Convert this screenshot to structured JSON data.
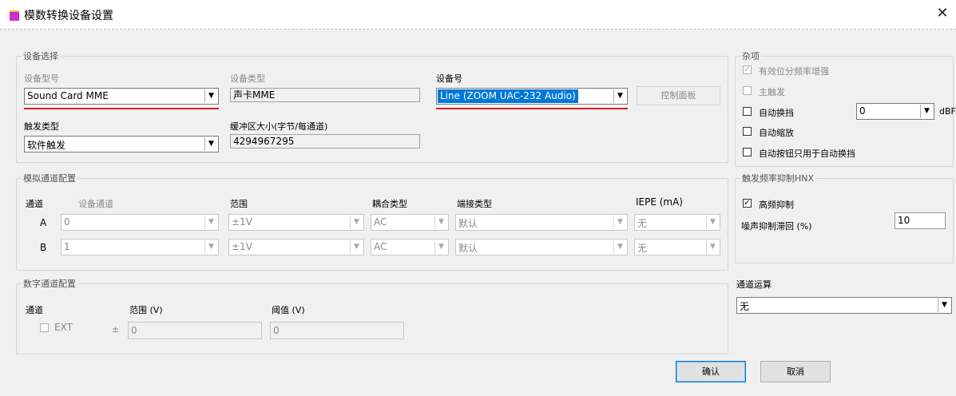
{
  "window": {
    "title": "模数转换设备设置",
    "close_glyph": "✕"
  },
  "device_select": {
    "legend": "设备选择",
    "model_label": "设备型号",
    "model_value": "Sound Card MME",
    "type_label": "设备类型",
    "type_value": "声卡MME",
    "number_label": "设备号",
    "number_value": "Line (ZOOM UAC-232 Audio)",
    "control_panel_button": "控制面板",
    "trigger_label": "触发类型",
    "trigger_value": "软件触发",
    "buffer_label": "缓冲区大小(字节/每通道)",
    "buffer_value": "4294967295"
  },
  "misc": {
    "legend": "杂项",
    "items": [
      {
        "label": "有效位分频率增强",
        "checked": true,
        "disabled": true
      },
      {
        "label": "主触发",
        "checked": false,
        "disabled": true
      },
      {
        "label": "自动换挡",
        "checked": false,
        "disabled": false
      },
      {
        "label": "自动缩放",
        "checked": false,
        "disabled": false
      },
      {
        "label": "自动按钮只用于自动换挡",
        "checked": false,
        "disabled": false
      }
    ],
    "dbfs_value": "0",
    "dbfs_unit": "dBFS"
  },
  "analog": {
    "legend": "模拟通道配置",
    "headers": {
      "channel": "通道",
      "device_channel": "设备通道",
      "range": "范围",
      "coupling": "耦合类型",
      "terminal": "端接类型",
      "iepe": "IEPE (mA)"
    },
    "rows": [
      {
        "channel": "A",
        "device_channel": "0",
        "range": "±1V",
        "coupling": "AC",
        "terminal": "默认",
        "iepe": "无"
      },
      {
        "channel": "B",
        "device_channel": "1",
        "range": "±1V",
        "coupling": "AC",
        "terminal": "默认",
        "iepe": "无"
      }
    ]
  },
  "trigger_suppress": {
    "legend": "触发频率抑制HNX",
    "hf_label": "高频抑制",
    "hf_checked": true,
    "hysteresis_label": "噪声抑制滞回 (%)",
    "hysteresis_value": "10"
  },
  "digital": {
    "legend": "数字通道配置",
    "channel_header": "通道",
    "range_header": "范围 (V)",
    "threshold_header": "阈值 (V)",
    "ext_label": "EXT",
    "plusminus": "±",
    "range_value": "0",
    "threshold_value": "0"
  },
  "channel_op": {
    "legend": "通道运算",
    "value": "无"
  },
  "buttons": {
    "ok": "确认",
    "cancel": "取消"
  },
  "glyphs": {
    "arrow": "▼",
    "check": "✓"
  }
}
